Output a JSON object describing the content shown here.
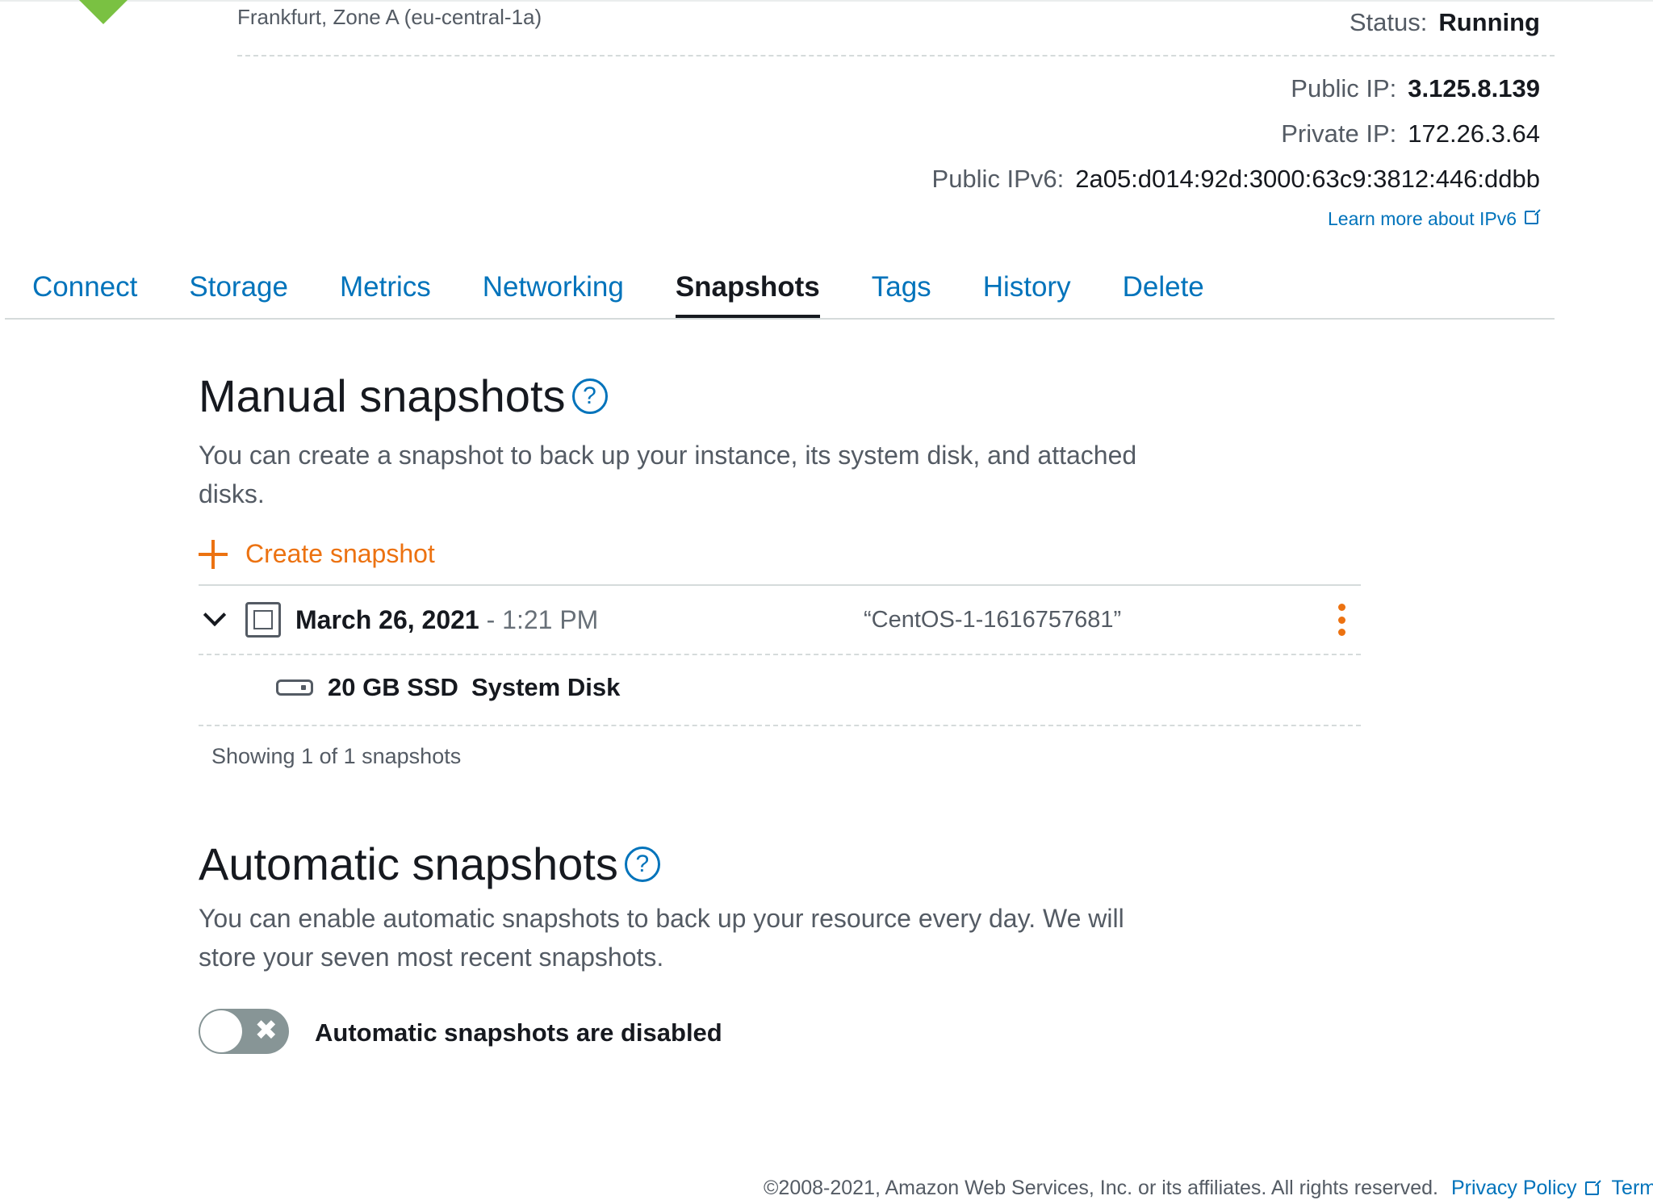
{
  "instance": {
    "zone": "Frankfurt, Zone A (eu-central-1a)",
    "status_label": "Status:",
    "status_value": "Running",
    "public_ip_label": "Public IP:",
    "public_ip_value": "3.125.8.139",
    "private_ip_label": "Private IP:",
    "private_ip_value": "172.26.3.64",
    "public_ipv6_label": "Public IPv6:",
    "public_ipv6_value": "2a05:d014:92d:3000:63c9:3812:446:ddbb",
    "learn_ipv6": "Learn more about IPv6"
  },
  "tabs": [
    {
      "label": "Connect",
      "active": false
    },
    {
      "label": "Storage",
      "active": false
    },
    {
      "label": "Metrics",
      "active": false
    },
    {
      "label": "Networking",
      "active": false
    },
    {
      "label": "Snapshots",
      "active": true
    },
    {
      "label": "Tags",
      "active": false
    },
    {
      "label": "History",
      "active": false
    },
    {
      "label": "Delete",
      "active": false
    }
  ],
  "manual": {
    "title": "Manual snapshots",
    "help": "?",
    "description": "You can create a snapshot to back up your instance, its system disk, and attached disks.",
    "create_label": "Create snapshot",
    "snapshot": {
      "date": "March 26, 2021",
      "time": " - 1:21 PM",
      "name": "“CentOS-1-1616757681”",
      "disk_size": "20 GB SSD",
      "disk_type": "System Disk"
    },
    "showing": "Showing 1 of 1 snapshots"
  },
  "automatic": {
    "title": "Automatic snapshots",
    "help": "?",
    "description": "You can enable automatic snapshots to back up your resource every day. We will store your seven most recent snapshots.",
    "toggle_x": "✖",
    "toggle_enabled": false,
    "toggle_label": "Automatic snapshots are disabled"
  },
  "footer": {
    "copyright": "©2008-2021, Amazon Web Services, Inc. or its affiliates. All rights reserved.",
    "privacy": "Privacy Policy",
    "terms": "Terms"
  },
  "colors": {
    "link": "#0073bb",
    "accent": "#ec7211",
    "logo": "#7ac142",
    "toggle_off": "#879596"
  },
  "icons": [
    "instance-logo-icon",
    "help-icon",
    "external-link-icon",
    "plus-icon",
    "chevron-down-icon",
    "snapshot-icon",
    "disk-icon",
    "kebab-menu-icon",
    "close-icon"
  ]
}
